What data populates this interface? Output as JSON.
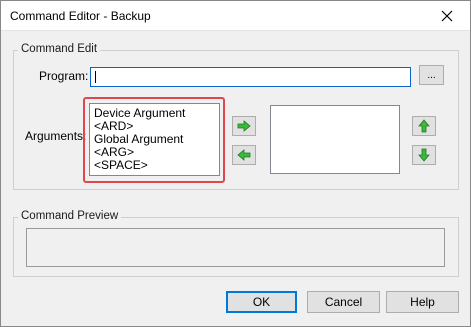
{
  "window": {
    "title": "Command Editor - Backup"
  },
  "command_edit": {
    "group_label": "Command Edit",
    "program_label": "Program:",
    "program_value": "",
    "browse_label": "...",
    "arguments_label": "Arguments:",
    "available_arguments": [
      "Device Argument <ARD>",
      "Global Argument <ARG>",
      "<SPACE>"
    ],
    "selected_arguments": []
  },
  "command_preview": {
    "group_label": "Command Preview",
    "value": ""
  },
  "footer": {
    "ok_label": "OK",
    "cancel_label": "Cancel",
    "help_label": "Help"
  },
  "colors": {
    "highlight": "#e0474c",
    "arrow_green": "#3cb83c",
    "focus_blue": "#0078d7"
  },
  "icons": {
    "close": "close-icon",
    "add": "arrow-right-icon",
    "remove": "arrow-left-icon",
    "move_up": "arrow-up-icon",
    "move_down": "arrow-down-icon"
  }
}
